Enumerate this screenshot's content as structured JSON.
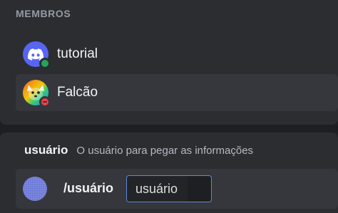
{
  "members": {
    "section_title": "MEMBROS",
    "items": [
      {
        "name": "tutorial",
        "avatar_icon": "discord-logo-icon",
        "status": "online",
        "status_color": "#23a55a"
      },
      {
        "name": "Falcão",
        "avatar_icon": "rainbow-fox-avatar",
        "status": "dnd",
        "status_color": "#f23f43"
      }
    ]
  },
  "option": {
    "name": "usuário",
    "description": "O usuário para pegar as informações"
  },
  "command": {
    "name": "/usuário",
    "param_label": "usuário",
    "avatar_color": "#6e7ad8"
  },
  "colors": {
    "background": "#1e1f22",
    "panel": "#2b2d31",
    "hover": "#35373c",
    "focus_border": "#5e8ad6"
  }
}
